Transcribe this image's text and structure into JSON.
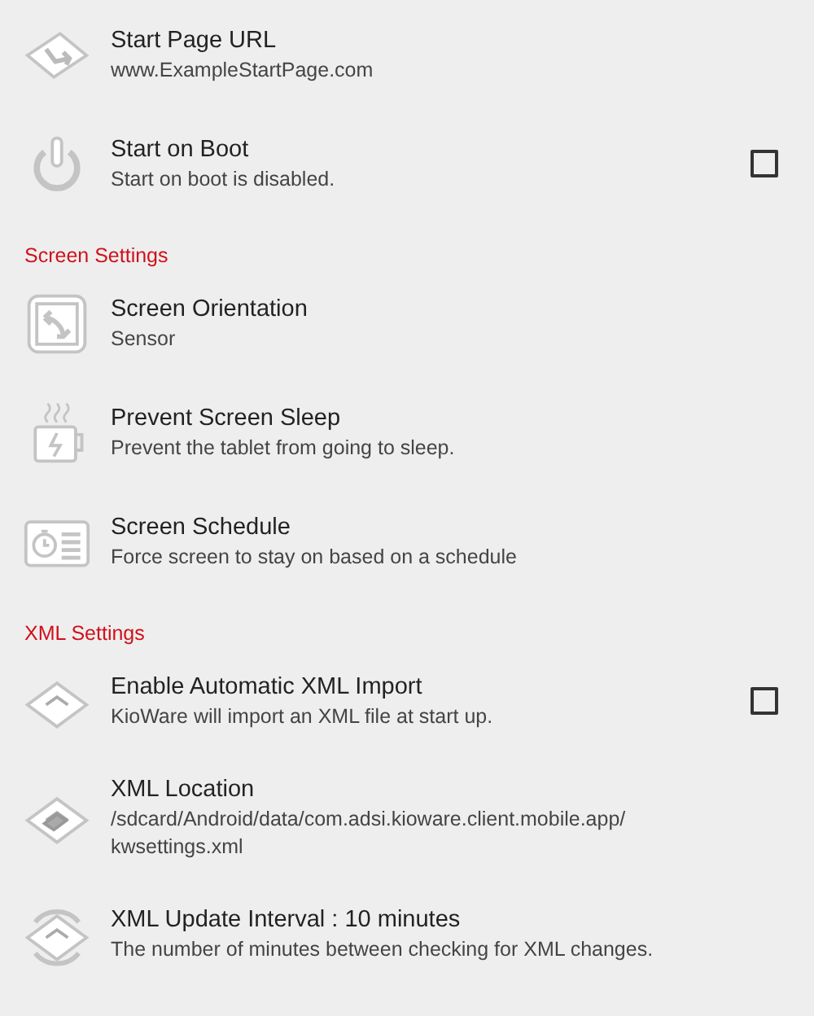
{
  "items": [
    {
      "kind": "setting",
      "title": "Start Page URL",
      "summary": "www.ExampleStartPage.com"
    },
    {
      "kind": "setting",
      "title": "Start on Boot",
      "summary": "Start on boot is disabled.",
      "checkbox": {
        "checked": false
      }
    },
    {
      "kind": "header",
      "title": "Screen Settings"
    },
    {
      "kind": "setting",
      "title": "Screen Orientation",
      "summary": "Sensor"
    },
    {
      "kind": "setting",
      "title": "Prevent Screen Sleep",
      "summary": "Prevent the tablet from going to sleep."
    },
    {
      "kind": "setting",
      "title": "Screen Schedule",
      "summary": "Force screen to stay on based on a schedule"
    },
    {
      "kind": "header",
      "title": "XML Settings"
    },
    {
      "kind": "setting",
      "title": "Enable Automatic XML Import",
      "summary": "KioWare will import an XML file at start up.",
      "checkbox": {
        "checked": false
      }
    },
    {
      "kind": "setting",
      "title": "XML Location",
      "summary": "/sdcard/Android/data/com.adsi.kioware.client.mobile.app/\nkwsettings.xml"
    },
    {
      "kind": "setting",
      "title": "XML Update Interval : 10 minutes",
      "summary": "The number of minutes between checking for XML changes."
    }
  ]
}
